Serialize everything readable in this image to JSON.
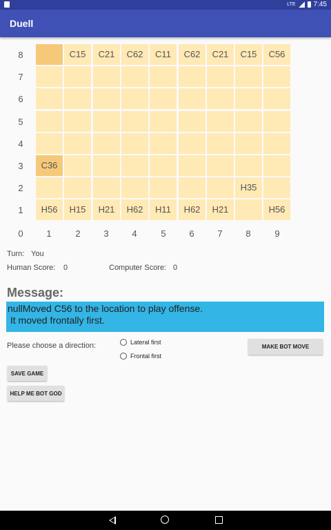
{
  "status_bar": {
    "time": "7:45",
    "network": "LTE"
  },
  "app": {
    "title": "Duell"
  },
  "board": {
    "row_labels": [
      "8",
      "7",
      "6",
      "5",
      "4",
      "3",
      "2",
      "1"
    ],
    "col_labels": [
      "0",
      "1",
      "2",
      "3",
      "4",
      "5",
      "6",
      "7",
      "8",
      "9"
    ],
    "rows": [
      [
        "",
        "C15",
        "C21",
        "C62",
        "C11",
        "C62",
        "C21",
        "C15",
        "C56"
      ],
      [
        "",
        "",
        "",
        "",
        "",
        "",
        "",
        "",
        ""
      ],
      [
        "",
        "",
        "",
        "",
        "",
        "",
        "",
        "",
        ""
      ],
      [
        "",
        "",
        "",
        "",
        "",
        "",
        "",
        "",
        ""
      ],
      [
        "",
        "",
        "",
        "",
        "",
        "",
        "",
        "",
        ""
      ],
      [
        "C36",
        "",
        "",
        "",
        "",
        "",
        "",
        "",
        ""
      ],
      [
        "",
        "",
        "",
        "",
        "",
        "",
        "",
        "H35",
        ""
      ],
      [
        "H56",
        "H15",
        "H21",
        "H62",
        "H11",
        "H62",
        "H21",
        "",
        "H56"
      ]
    ],
    "highlighted": [
      "8-1",
      "3-1"
    ],
    "colors": {
      "cell": "#ffe9b5",
      "highlight": "#f6c97a"
    }
  },
  "turn": {
    "label": "Turn:",
    "value": "You"
  },
  "scores": {
    "human_label": "Human Score:",
    "human_value": "0",
    "computer_label": "Computer Score:",
    "computer_value": "0"
  },
  "message": {
    "title": "Message:",
    "line1": "nullMoved C56 to the location to play offense.",
    "line2": " It moved frontally first.",
    "color": "#33b5e5"
  },
  "direction": {
    "prompt": "Please choose a direction:",
    "options": [
      "Lateral first",
      "Frontal first"
    ]
  },
  "buttons": {
    "make_bot_move": "MAKE BOT MOVE",
    "save_game": "SAVE GAME",
    "help": "HELP ME BOT GOD"
  },
  "nav": {
    "back": "back-icon",
    "home": "home-icon",
    "recent": "recent-apps-icon"
  }
}
